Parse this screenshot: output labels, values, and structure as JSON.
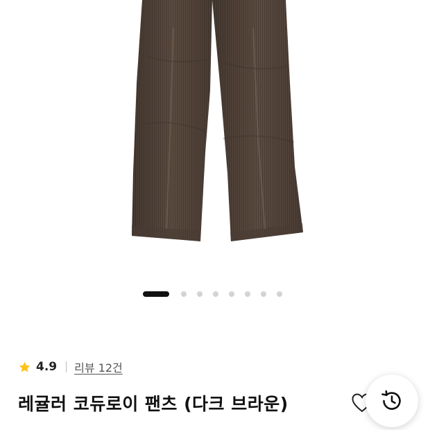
{
  "gallery": {
    "image_alt": "dark brown corduroy pants",
    "slide_count": 8,
    "active_slide": 1
  },
  "product": {
    "rating": "4.9",
    "review_label": "리뷰 12건",
    "name": "레귤러 코듀로이 팬츠 (다크 브라운)"
  },
  "icons": {
    "rating": "star-icon",
    "wishlist": "heart-icon",
    "recent": "history-icon"
  },
  "colors": {
    "star": "#FFC21A",
    "pants": "#5a4a3f",
    "active_dot": "#111111",
    "inactive_dot": "#d3d3d3"
  }
}
